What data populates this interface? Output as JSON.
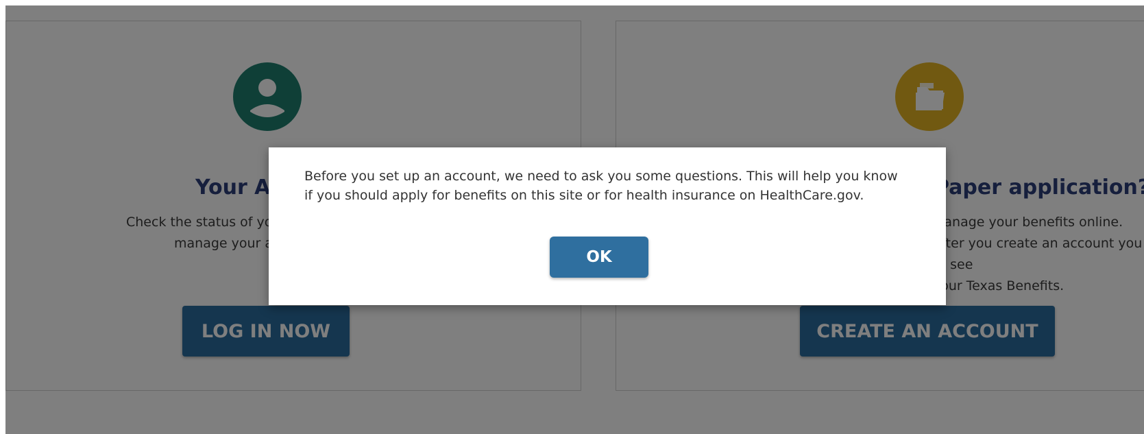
{
  "left_card": {
    "title": "Your Account",
    "description_line1": "Check the status of your benefits and",
    "description_line2": "manage your account.",
    "button_label": "LOG IN NOW",
    "icon": "user-icon",
    "icon_color": "#1f7f6f"
  },
  "right_card": {
    "title": "Paper application?",
    "description_line1": "Manage your benefits online.",
    "description_line2": "After you create an account you will be able to see",
    "description_line3": "your Texas Benefits.",
    "button_label": "CREATE AN ACCOUNT",
    "icon": "folder-icon",
    "icon_color": "#e2b322"
  },
  "modal": {
    "message": "Before you set up an account, we need to ask you some questions. This will help you know if you should apply for benefits on this site or for health insurance on HealthCare.gov.",
    "ok_label": "OK"
  },
  "colors": {
    "button_blue": "#2b6d9e",
    "title_navy": "#2c3e7a",
    "overlay": "rgba(0,0,0,0.5)"
  }
}
